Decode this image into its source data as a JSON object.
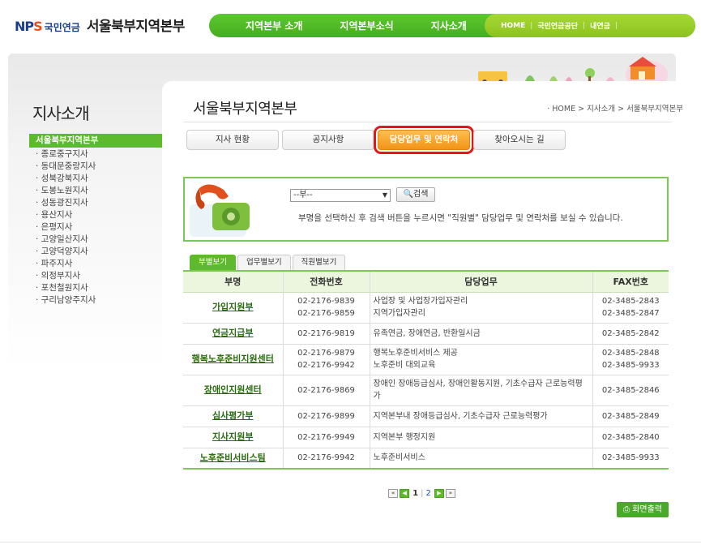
{
  "header": {
    "logo_nps": "NPS",
    "logo_sub": "국민연금",
    "title": "서울북부지역본부",
    "gnb": [
      "지역본부 소개",
      "지역본부소식",
      "지사소개"
    ],
    "util": [
      "HOME",
      "국민연금공단",
      "내연금"
    ]
  },
  "lnb": {
    "title": "지사소개",
    "items": [
      "서울북부지역본부",
      "· 종로중구지사",
      "· 동대문중랑지사",
      "· 성북강북지사",
      "· 도봉노원지사",
      "· 성동광진지사",
      "· 용산지사",
      "· 은평지사",
      "· 고양일산지사",
      "· 고양덕양지사",
      "· 파주지사",
      "· 의정부지사",
      "· 포천철원지사",
      "· 구리남양주지사"
    ]
  },
  "content": {
    "title": "서울북부지역본부",
    "breadcrumb": "· HOME > 지사소개 > 서울북부지역본부",
    "tabs": [
      "지사 현황",
      "공지사항",
      "담당업무 및 연락처",
      "찾아오시는 길"
    ],
    "search": {
      "select_value": "--부--",
      "button": "검색",
      "note": "부명을 선택하신 후 검색 버튼을 누르시면 \"직원별\" 담당업무 및 연락처를 보실 수 있습니다."
    },
    "subtabs": [
      "부별보기",
      "업무별보기",
      "직원별보기"
    ],
    "table": {
      "headers": [
        "부명",
        "전화번호",
        "담당업무",
        "FAX번호"
      ],
      "rows": [
        {
          "dept": "가입지원부",
          "phone": "02-2176-9839\n02-2176-9859",
          "duty": "사업장 및 사업장가입자관리\n지역가입자관리",
          "fax": "02-3485-2843\n02-3485-2847"
        },
        {
          "dept": "연금지급부",
          "phone": "02-2176-9819",
          "duty": "유족연금, 장애연금, 반환일시금",
          "fax": "02-3485-2842"
        },
        {
          "dept": "행복노후준비지원센터",
          "phone": "02-2176-9879\n02-2176-9942",
          "duty": "행복노후준비서비스 제공\n노후준비 대외교육",
          "fax": "02-3485-2848\n02-3485-9933"
        },
        {
          "dept": "장애인지원센터",
          "phone": "02-2176-9869",
          "duty": "장애인 장애등급심사, 장애인활동지원, 기초수급자 근로능력평가",
          "fax": "02-3485-2846"
        },
        {
          "dept": "심사평가부",
          "phone": "02-2176-9899",
          "duty": "지역본부내 장애등급심사, 기초수급자 근로능력평가",
          "fax": "02-3485-2849"
        },
        {
          "dept": "지사지원부",
          "phone": "02-2176-9949",
          "duty": "지역본부 행정지원",
          "fax": "02-3485-2840"
        },
        {
          "dept": "노후준비서비스팀",
          "phone": "02-2176-9942",
          "duty": "노후준비서비스",
          "fax": "02-3485-9933"
        }
      ]
    },
    "paging": {
      "current": "1",
      "next": "2",
      "sep": "|"
    },
    "print": "화면출력"
  }
}
